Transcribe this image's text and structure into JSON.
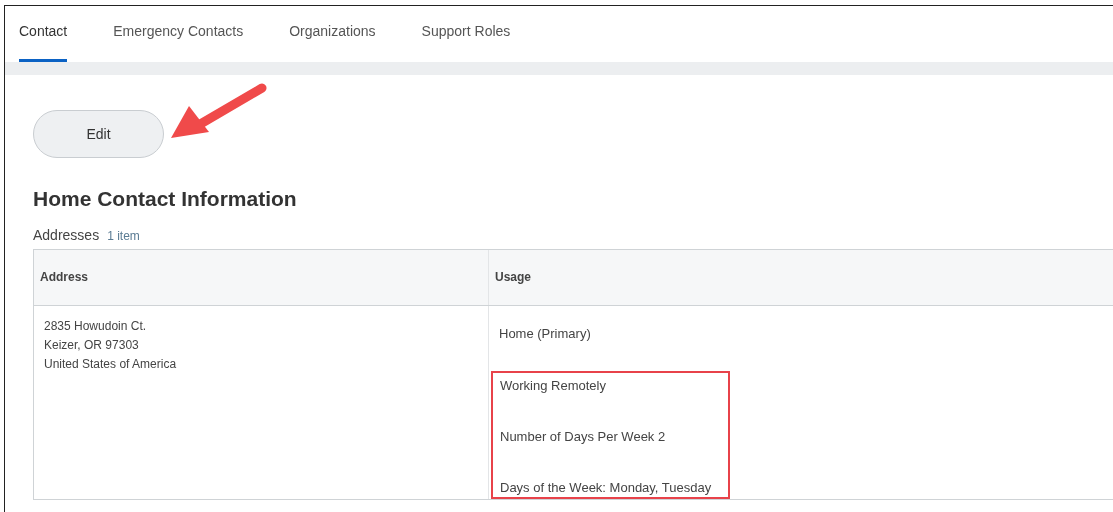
{
  "tabs": [
    {
      "label": "Contact",
      "selected": true
    },
    {
      "label": "Emergency Contacts",
      "selected": false
    },
    {
      "label": "Organizations",
      "selected": false
    },
    {
      "label": "Support Roles",
      "selected": false
    }
  ],
  "edit_button": "Edit",
  "section_title": "Home Contact Information",
  "addresses": {
    "label": "Addresses",
    "count": "1 item",
    "columns": [
      "Address",
      "Usage"
    ],
    "rows": [
      {
        "address": [
          "2835 Howudoin Ct.",
          "Keizer, OR 97303",
          "United States of America"
        ],
        "usage": [
          {
            "text": "Home (Primary)",
            "highlighted": false
          },
          {
            "text": "Working Remotely",
            "highlighted": true
          },
          {
            "text": "Number of Days Per Week 2",
            "highlighted": true
          },
          {
            "text": "Days of the Week: Monday, Tuesday",
            "highlighted": true
          }
        ]
      }
    ]
  }
}
